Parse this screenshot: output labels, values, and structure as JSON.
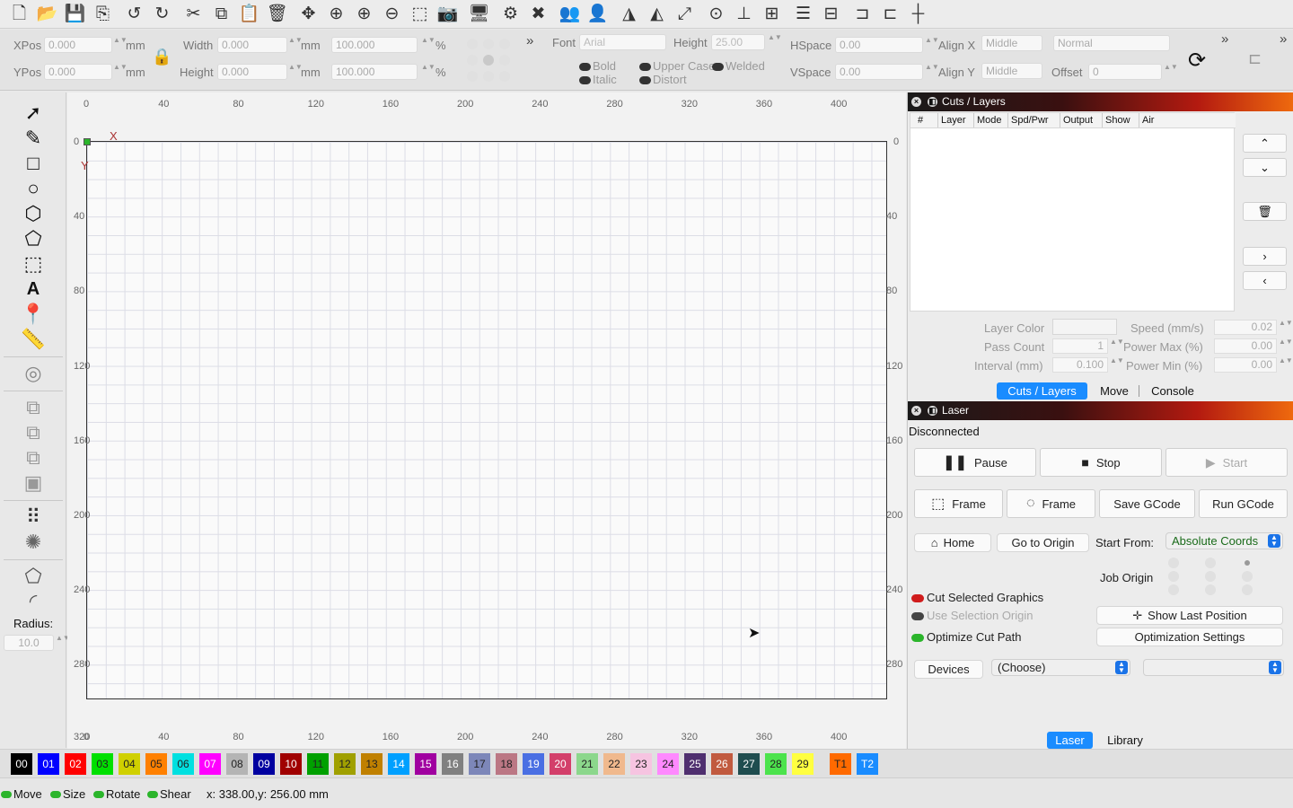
{
  "toolbar": {
    "icons": [
      "new-file",
      "open",
      "save",
      "export",
      "undo",
      "redo",
      "cut",
      "copy",
      "paste",
      "delete",
      "move",
      "zoom-in",
      "zoom-in-2",
      "zoom-out",
      "zoom-frame",
      "camera",
      "monitor",
      "settings",
      "tools",
      "users",
      "user",
      "align-left",
      "mirror-h",
      "mirror-v",
      "target",
      "align-center",
      "distribute",
      "align-top",
      "align-middle",
      "dock",
      "grid"
    ]
  },
  "props": {
    "xpos_label": "XPos",
    "xpos_value": "0.000",
    "ypos_label": "YPos",
    "ypos_value": "0.000",
    "unit": "mm",
    "width_label": "Width",
    "width_value": "0.000",
    "height_label": "Height",
    "height_value": "0.000",
    "scale_w": "100.000",
    "scale_h": "100.000",
    "percent": "%",
    "font_label": "Font",
    "font_value": "Arial",
    "font_height_label": "Height",
    "font_height_value": "25.00",
    "hspace_label": "HSpace",
    "hspace_value": "0.00",
    "vspace_label": "VSpace",
    "vspace_value": "0.00",
    "alignx_label": "Align X",
    "alignx_value": "Middle",
    "aligny_label": "Align Y",
    "aligny_value": "Middle",
    "normal_value": "Normal",
    "offset_label": "Offset",
    "offset_value": "0",
    "bold": "Bold",
    "italic": "Italic",
    "upper_case": "Upper Case",
    "welded": "Welded",
    "distort": "Distort",
    "expand_chevron": "»"
  },
  "lefttools": {
    "radius_label": "Radius:",
    "radius_value": "10.0"
  },
  "canvas": {
    "origin_x_label": "X",
    "origin_y_label": "Y",
    "x_ticks": [
      "0",
      "40",
      "80",
      "120",
      "160",
      "200",
      "240",
      "280",
      "320",
      "360",
      "400"
    ],
    "y_ticks": [
      "0",
      "40",
      "80",
      "120",
      "160",
      "200",
      "240",
      "280"
    ],
    "y_ticks_right": [
      "0",
      "40",
      "80",
      "120",
      "160",
      "200",
      "240",
      "280"
    ],
    "bottom_ticks": [
      "0",
      "40",
      "80",
      "120",
      "160",
      "200",
      "240",
      "280",
      "320",
      "360",
      "400",
      "320"
    ],
    "right_ticks": [
      "0",
      "40",
      "80",
      "120",
      "160",
      "200",
      "240",
      "280"
    ]
  },
  "cuts": {
    "title": "Cuts / Layers",
    "columns": [
      "#",
      "Layer",
      "Mode",
      "Spd/Pwr",
      "Output",
      "Show",
      "Air"
    ],
    "layer_color_label": "Layer Color",
    "speed_label": "Speed (mm/s)",
    "speed_value": "0.02",
    "pass_count_label": "Pass Count",
    "pass_count_value": "1",
    "power_max_label": "Power Max (%)",
    "power_max_value": "0.00",
    "interval_label": "Interval (mm)",
    "interval_value": "0.100",
    "power_min_label": "Power Min (%)",
    "power_min_value": "0.00",
    "tabs": [
      "Cuts / Layers",
      "Move",
      "Console"
    ]
  },
  "laser": {
    "title": "Laser",
    "status": "Disconnected",
    "pause": "Pause",
    "stop": "Stop",
    "start": "Start",
    "frame1": "Frame",
    "frame2": "Frame",
    "save_gcode": "Save GCode",
    "run_gcode": "Run GCode",
    "home": "Home",
    "go_to_origin": "Go to Origin",
    "start_from_label": "Start From:",
    "start_from_value": "Absolute Coords",
    "job_origin_label": "Job Origin",
    "cut_selected": "Cut Selected Graphics",
    "use_selection_origin": "Use Selection Origin",
    "optimize_cut_path": "Optimize Cut Path",
    "show_last_position": "Show Last Position",
    "optimization_settings": "Optimization Settings",
    "devices": "Devices",
    "devices_value": "(Choose)",
    "bottom_tabs": [
      "Laser",
      "Library"
    ]
  },
  "palette": [
    {
      "label": "00",
      "color": "#000000",
      "text": "#ffffff"
    },
    {
      "label": "01",
      "color": "#0000ff",
      "text": "#ffffff"
    },
    {
      "label": "02",
      "color": "#ff0000",
      "text": "#ffffff"
    },
    {
      "label": "03",
      "color": "#00e000",
      "text": "#222222"
    },
    {
      "label": "04",
      "color": "#d0d000",
      "text": "#222222"
    },
    {
      "label": "05",
      "color": "#ff8000",
      "text": "#222222"
    },
    {
      "label": "06",
      "color": "#00e0e0",
      "text": "#222222"
    },
    {
      "label": "07",
      "color": "#ff00ff",
      "text": "#ffffff"
    },
    {
      "label": "08",
      "color": "#b4b4b4",
      "text": "#222222"
    },
    {
      "label": "09",
      "color": "#0000a0",
      "text": "#ffffff"
    },
    {
      "label": "10",
      "color": "#a00000",
      "text": "#ffffff"
    },
    {
      "label": "11",
      "color": "#00a000",
      "text": "#222222"
    },
    {
      "label": "12",
      "color": "#a0a000",
      "text": "#222222"
    },
    {
      "label": "13",
      "color": "#c08000",
      "text": "#222222"
    },
    {
      "label": "14",
      "color": "#00a0ff",
      "text": "#ffffff"
    },
    {
      "label": "15",
      "color": "#a000a0",
      "text": "#ffffff"
    },
    {
      "label": "16",
      "color": "#808080",
      "text": "#ffffff"
    },
    {
      "label": "17",
      "color": "#7d87b9",
      "text": "#222222"
    },
    {
      "label": "18",
      "color": "#bb7784",
      "text": "#222222"
    },
    {
      "label": "19",
      "color": "#4a6fe3",
      "text": "#ffffff"
    },
    {
      "label": "20",
      "color": "#d33f6a",
      "text": "#ffffff"
    },
    {
      "label": "21",
      "color": "#8cd78c",
      "text": "#222222"
    },
    {
      "label": "22",
      "color": "#f0b98d",
      "text": "#222222"
    },
    {
      "label": "23",
      "color": "#f6c4e1",
      "text": "#222222"
    },
    {
      "label": "24",
      "color": "#fe89fe",
      "text": "#222222"
    },
    {
      "label": "25",
      "color": "#4f2f6f",
      "text": "#ffffff"
    },
    {
      "label": "26",
      "color": "#c15a3f",
      "text": "#ffffff"
    },
    {
      "label": "27",
      "color": "#1f4d4f",
      "text": "#ffffff"
    },
    {
      "label": "28",
      "color": "#4ce34c",
      "text": "#222222"
    },
    {
      "label": "29",
      "color": "#ffff40",
      "text": "#222222"
    },
    {
      "label": "T1",
      "color": "#ff6a00",
      "text": "#222222"
    },
    {
      "label": "T2",
      "color": "#1a8cff",
      "text": "#ffffff"
    }
  ],
  "status": {
    "move": "Move",
    "size": "Size",
    "rotate": "Rotate",
    "shear": "Shear",
    "coords": "x: 338.00,y: 256.00 mm"
  }
}
